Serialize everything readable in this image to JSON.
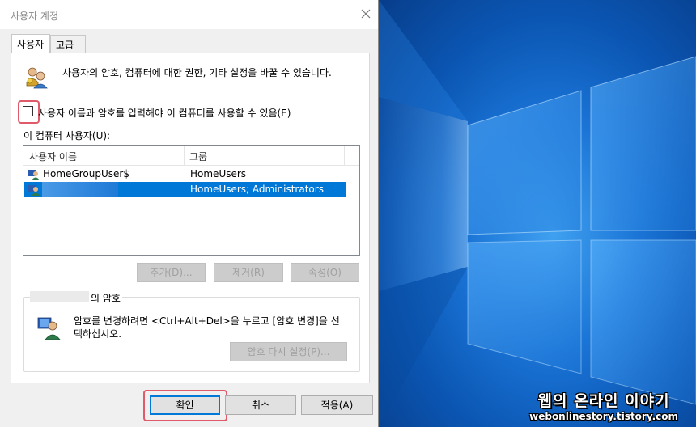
{
  "dialog": {
    "title": "사용자 계정",
    "tabs": [
      {
        "label": "사용자",
        "active": true
      },
      {
        "label": "고급",
        "active": false
      }
    ],
    "description": "사용자의 암호, 컴퓨터에 대한 권한, 기타 설정을 바꿀 수 있습니다.",
    "require_login_checkbox": {
      "label": "사용자 이름과 암호를 입력해야 이 컴퓨터를 사용할 수 있음(E)",
      "checked": false
    },
    "users_label": "이 컴퓨터 사용자(U):",
    "users_table": {
      "columns": [
        "사용자 이름",
        "그룹"
      ],
      "rows": [
        {
          "name": "HomeGroupUser$",
          "group": "HomeUsers",
          "selected": false
        },
        {
          "name": "",
          "group": "HomeUsers; Administrators",
          "selected": true
        }
      ]
    },
    "user_buttons": {
      "add": "추가(D)...",
      "remove": "제거(R)",
      "properties": "속성(O)"
    },
    "password_group": {
      "title_suffix": "의 암호",
      "text_line1": "암호를 변경하려면 <Ctrl+Alt+Del>을 누르고 [암호 변경]을 선",
      "text_line2": "택하십시오.",
      "reset_button": "암호 다시 설정(P)..."
    },
    "footer_buttons": {
      "ok": "확인",
      "cancel": "취소",
      "apply": "적용(A)"
    }
  },
  "watermark": {
    "title": "웹의 온라인 이야기",
    "url": "webonlinestory.tistory.com"
  },
  "colors": {
    "selection": "#0078d7",
    "highlight_box": "#e05a6a",
    "desktop_blue": "#1a74d6"
  }
}
